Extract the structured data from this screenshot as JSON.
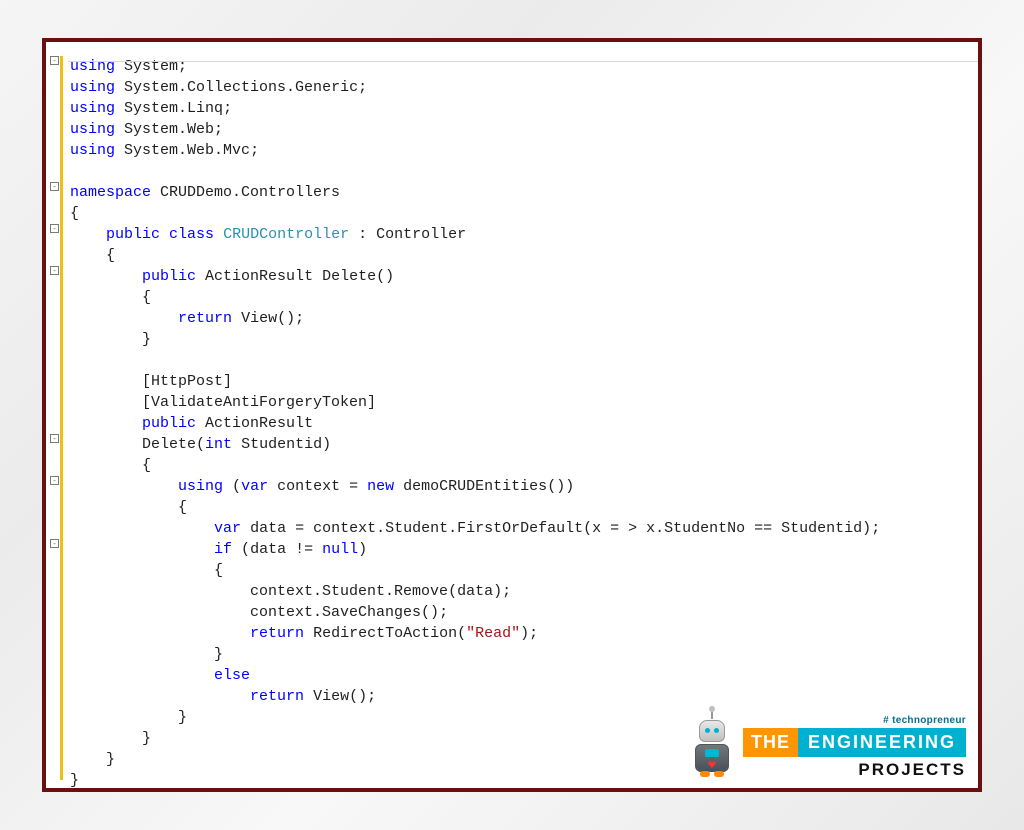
{
  "code": {
    "using": "using",
    "namespace": "namespace",
    "public": "public",
    "class": "class",
    "return": "return",
    "int": "int",
    "var": "var",
    "new": "new",
    "if": "if",
    "null": "null",
    "else": "else",
    "ns_System": "System",
    "ns_Collections": "System.Collections.Generic",
    "ns_Linq": "System.Linq",
    "ns_Web": "System.Web",
    "ns_Mvc": "System.Web.Mvc",
    "ns_CRUDDemo": "CRUDDemo.Controllers",
    "cls_CRUDController": "CRUDController",
    "cls_Controller": "Controller",
    "ActionResult": "ActionResult",
    "Delete": "Delete",
    "View": "View",
    "HttpPost": "[HttpPost]",
    "ValidateAnti": "[ValidateAntiForgeryToken]",
    "Studentid": "Studentid",
    "context": "context",
    "demoCRUDEntities": "demoCRUDEntities",
    "data": "data",
    "firstOrDefault": "context.Student.FirstOrDefault(x = > x.StudentNo == Studentid)",
    "remove": "context.Student.Remove(data)",
    "saveChanges": "context.SaveChanges()",
    "RedirectToAction": "RedirectToAction",
    "readStr": "\"Read\""
  },
  "logo": {
    "techno": "# technopreneur",
    "the": "THE",
    "engineering": "ENGINEERING",
    "projects": "PROJECTS"
  }
}
